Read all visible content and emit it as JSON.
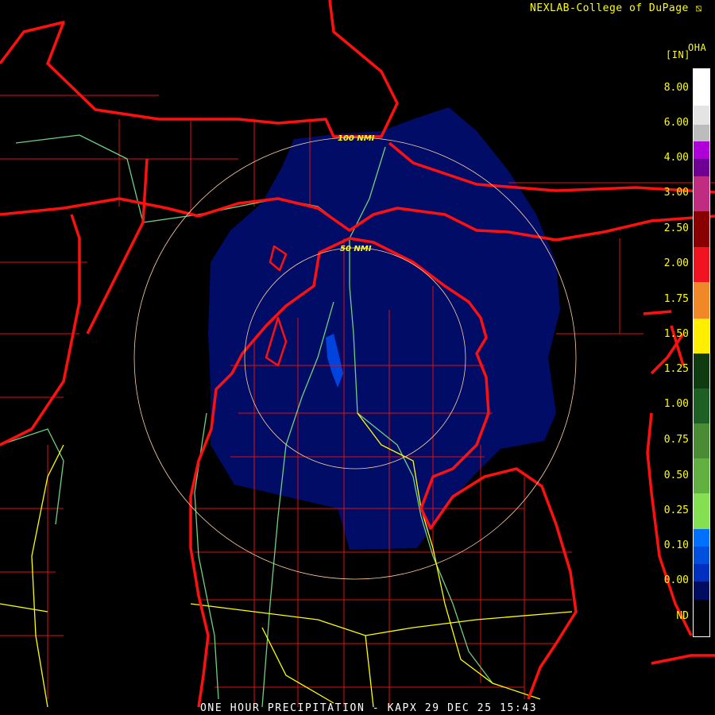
{
  "header": {
    "credit": "NEXLAB-College of DuPage",
    "credit_icon": "nexlab-logo-icon"
  },
  "legend": {
    "units": "[IN]",
    "product": "OHA",
    "items": [
      {
        "label": "8.00",
        "color": "#ffffff"
      },
      {
        "label": "6.00",
        "color": "#e4e4e4"
      },
      {
        "label": "",
        "color": "#bcbcbc"
      },
      {
        "label": "4.00",
        "color": "#b000d8"
      },
      {
        "label": "",
        "color": "#700094"
      },
      {
        "label": "3.00",
        "color": "#c02c80"
      },
      {
        "label": "2.50",
        "color": "#880000"
      },
      {
        "label": "2.00",
        "color": "#f01420"
      },
      {
        "label": "1.75",
        "color": "#f08828"
      },
      {
        "label": "1.50",
        "color": "#ffee00"
      },
      {
        "label": "1.25",
        "color": "#0e3c10"
      },
      {
        "label": "1.00",
        "color": "#1e6024"
      },
      {
        "label": "0.75",
        "color": "#4a8c34"
      },
      {
        "label": "0.50",
        "color": "#62b040"
      },
      {
        "label": "0.25",
        "color": "#84e050"
      },
      {
        "label": "0.10",
        "color": "#0070ff"
      },
      {
        "label": "",
        "color": "#0050e0"
      },
      {
        "label": "0.00",
        "color": "#0030c0"
      },
      {
        "label": "",
        "color": "#000c60"
      },
      {
        "label": "ND",
        "color": "#000000"
      }
    ]
  },
  "map": {
    "range_rings": [
      {
        "label": "100 NMI"
      },
      {
        "label": "50 NMI"
      }
    ],
    "colors": {
      "radar": "#000c66",
      "radar_light": "#0044dd",
      "coast": "#ff1010",
      "county": "#e01010",
      "highway_green": "#70d080",
      "highway_yellow": "#ffff00",
      "ring": "#ffd0a0"
    }
  },
  "caption": "ONE HOUR PRECIPITATION - KAPX 29 DEC 25 15:43"
}
